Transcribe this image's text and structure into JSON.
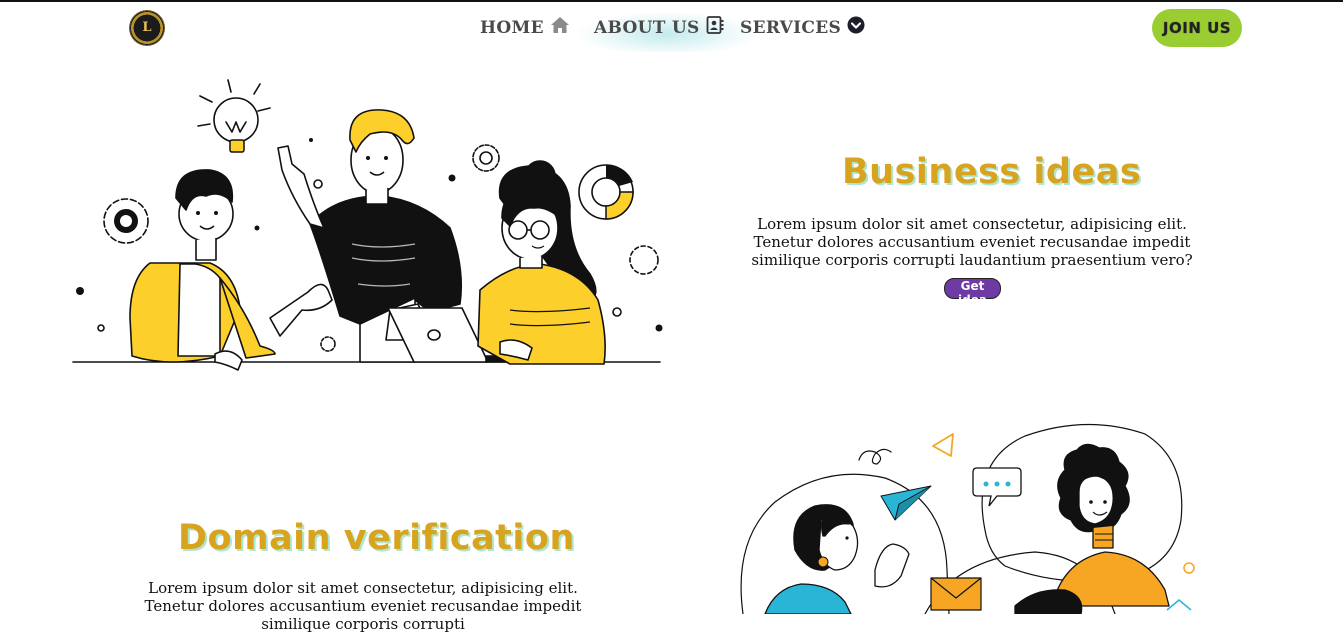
{
  "nav": {
    "logo_text": "L",
    "home": "HOME",
    "about": "ABOUT US",
    "services": "SERVICES",
    "join": "JOIN US",
    "icons": {
      "home": "home-icon",
      "about": "contact-card-icon",
      "services": "chevron-circle-down-icon"
    }
  },
  "section1": {
    "title": "Business ideas",
    "text": "Lorem ipsum dolor sit amet consectetur, adipisicing elit. Tenetur dolores accusantium eveniet recusandae impedit similique corporis corrupti laudantium praesentium vero?",
    "button": "Get idea",
    "illustration": "team-brainstorm-illustration"
  },
  "section2": {
    "title": "Domain verification",
    "text": "Lorem ipsum dolor sit amet consectetur, adipisicing elit. Tenetur dolores accusantium eveniet recusandae impedit similique corporis corrupti",
    "illustration": "video-chat-illustration"
  },
  "colors": {
    "accent_yellow": "#d8a31e",
    "heading_shadow": "#aee6cf",
    "join_green": "#9acd32",
    "idea_purple": "#6f3aa3",
    "illus_yellow": "#fccf2b",
    "illus_orange": "#f6a623",
    "illus_cyan": "#29b6d6"
  }
}
